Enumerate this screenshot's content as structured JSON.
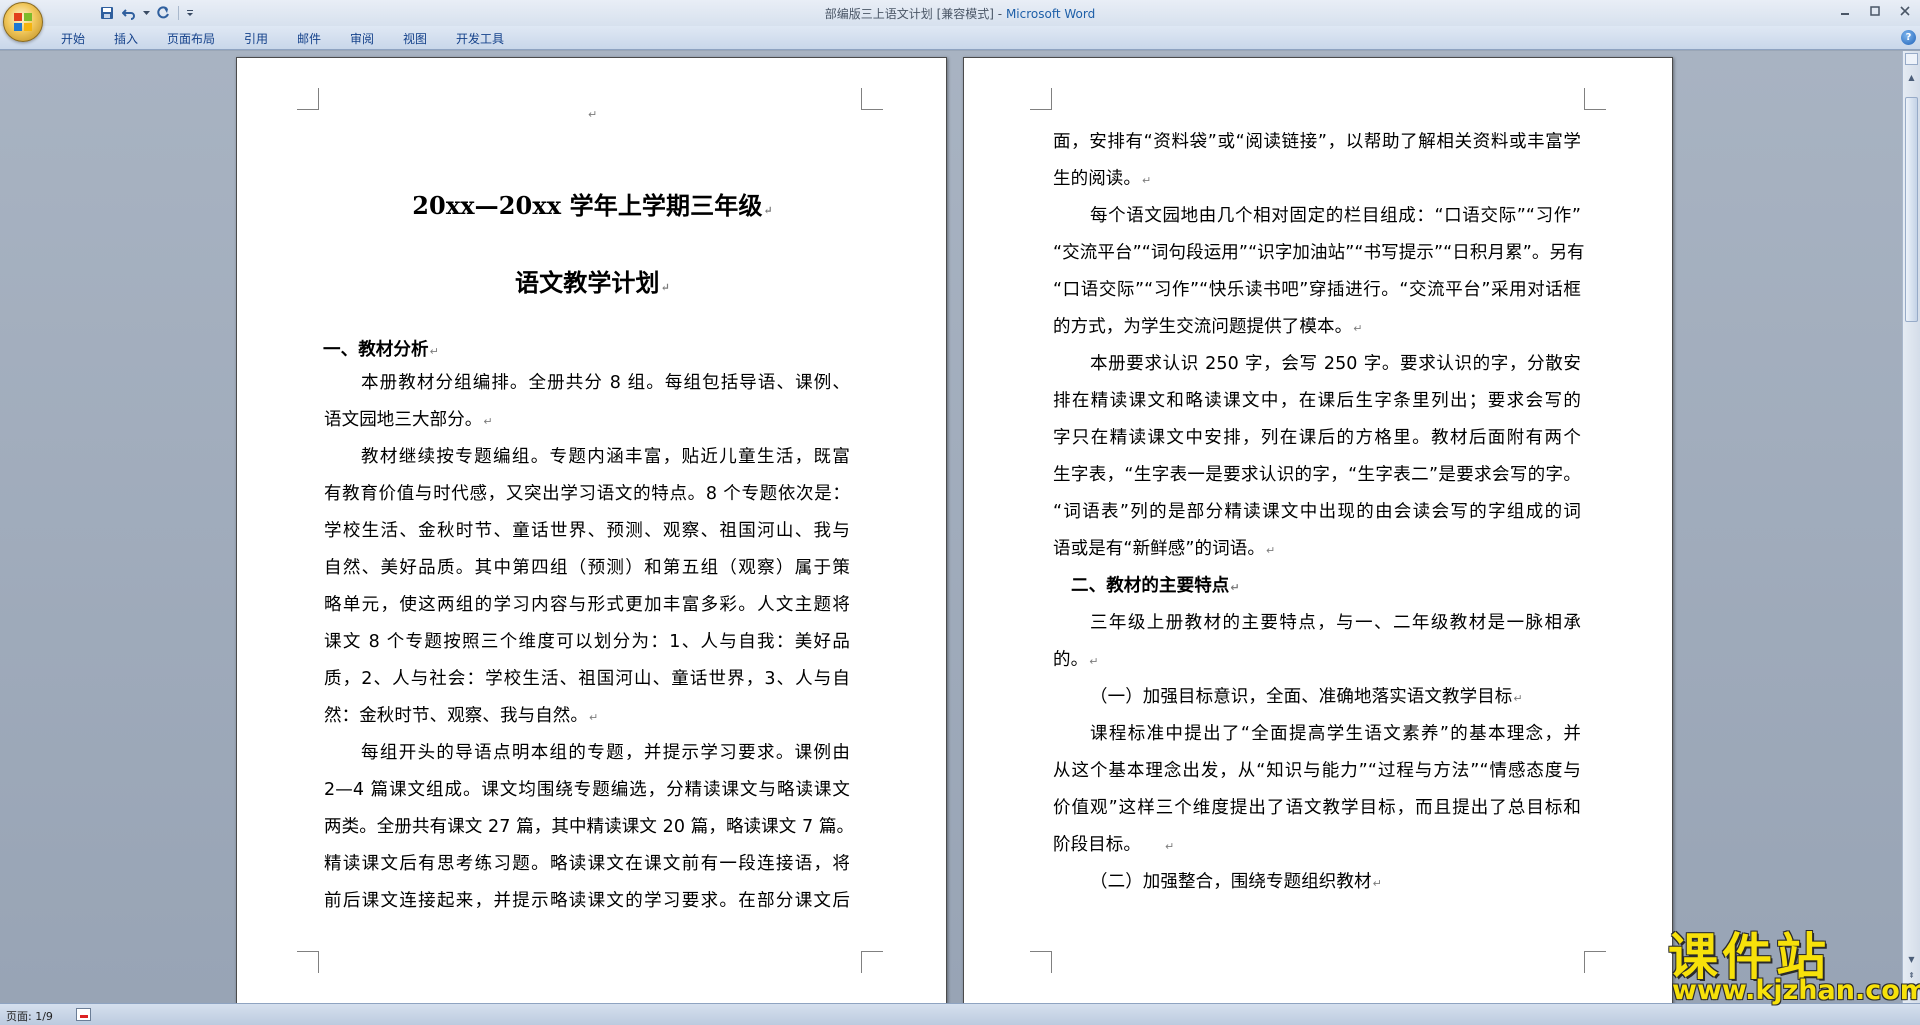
{
  "window": {
    "title_doc": "部编版三上语文计划 [兼容模式]",
    "title_sep": " - ",
    "title_app": "Microsoft Word"
  },
  "quick_access": {
    "save_icon": "save-icon",
    "undo_icon": "undo-icon",
    "redo_icon": "redo-icon",
    "customize_icon": "customize-qat-icon"
  },
  "ribbon": {
    "tabs": [
      "开始",
      "插入",
      "页面布局",
      "引用",
      "邮件",
      "审阅",
      "视图",
      "开发工具"
    ]
  },
  "page1": {
    "heading1": "20xx—20xx 学年上学期三年级",
    "heading2": "语文教学计划",
    "section1": "一、教材分析",
    "lines": [
      "本册教材分组编排。全册共分 8 组。每组包括导语、课例、",
      "语文园地三大部分。",
      "教材继续按专题编组。专题内涵丰富，贴近儿童生活，既富",
      "有教育价值与时代感，又突出学习语文的特点。8 个专题依次是：",
      "学校生活、金秋时节、童话世界、预测、观察、祖国河山、我与",
      "自然、美好品质。其中第四组（预测）和第五组（观察）属于策",
      "略单元，使这两组的学习内容与形式更加丰富多彩。人文主题将",
      "课文 8 个专题按照三个维度可以划分为：1、人与自我：美好品",
      "质，2、人与社会：学校生活、祖国河山、童话世界，3、人与自",
      "然：金秋时节、观察、我与自然。",
      "每组开头的导语点明本组的专题，并提示学习要求。课例由",
      "2—4 篇课文组成。课文均围绕专题编选，分精读课文与略读课文",
      "两类。全册共有课文 27 篇，其中精读课文 20 篇，略读课文 7 篇。",
      "精读课文后有思考练习题。略读课文在课文前有一段连接语，将",
      "前后课文连接起来，并提示略读课文的学习要求。在部分课文后"
    ]
  },
  "page2": {
    "lines": [
      "面，安排有“资料袋”或“阅读链接”，以帮助了解相关资料或丰富学",
      "生的阅读。",
      "每个语文园地由几个相对固定的栏目组成：“口语交际”“习作”",
      "“交流平台”“词句段运用”“识字加油站”“书写提示”“日积月累”。另有",
      "“口语交际”“习作”“快乐读书吧”穿插进行。“交流平台”采用对话框",
      "的方式，为学生交流问题提供了模本。",
      "本册要求认识 250 字，会写 250 字。要求认识的字，分散安",
      "排在精读课文和略读课文中，在课后生字条里列出；要求会写的",
      "字只在精读课文中安排，列在课后的方格里。教材后面附有两个",
      "生字表，“生字表一是要求认识的字，“生字表二”是要求会写的字。",
      "“词语表”列的是部分精读课文中出现的由会读会写的字组成的词",
      "语或是有“新鲜感”的词语。",
      "二、教材的主要特点",
      "三年级上册教材的主要特点，与一、二年级教材是一脉相承",
      "的。",
      "（一）加强目标意识，全面、准确地落实语文教学目标",
      "课程标准中提出了“全面提高学生语文素养”的基本理念，并",
      "从这个基本理念出发，从“知识与能力”“过程与方法”“情感态度与",
      "价值观”这样三个维度提出了语文教学目标，而且提出了总目标和",
      "阶段目标。",
      "（二）加强整合，围绕专题组织教材"
    ]
  },
  "status": {
    "page_count": "页面: 1/9"
  },
  "watermark": {
    "name": "课件站",
    "url": "www.kjzhan.com"
  },
  "colors": {
    "ribbon_text": "#15428b",
    "app_title": "#1d5fa8",
    "workspace": "#9aa6b6",
    "watermark": "#f7e10a"
  }
}
